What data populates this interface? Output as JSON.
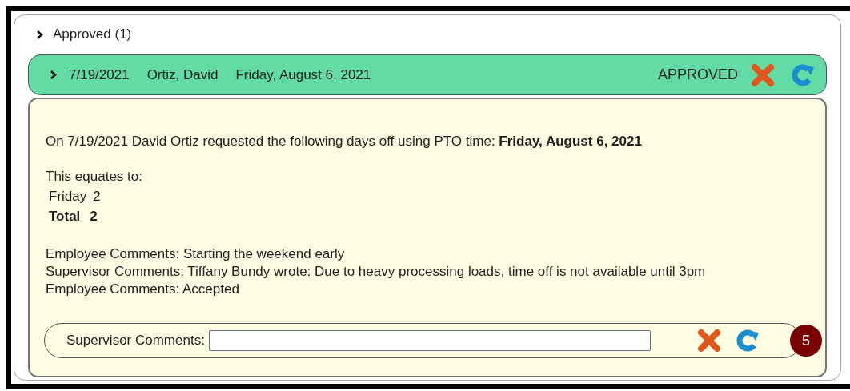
{
  "section": {
    "label": "Approved (1)"
  },
  "request": {
    "date": "7/19/2021",
    "employee": "Ortiz, David",
    "days": "Friday, August 6, 2021",
    "status": "APPROVED"
  },
  "details": {
    "summary": "On 7/19/2021 David Ortiz requested the following days off using PTO time: **Friday, August 6, 2021**",
    "equates_label": "This equates to:",
    "breakdown": [
      {
        "kind": "day",
        "label": "Friday",
        "hours": "2"
      },
      {
        "kind": "total",
        "label": "Total",
        "hours": "2"
      }
    ],
    "comments": [
      "Employee Comments: Starting the weekend early",
      "Supervisor Comments: Tiffany Bundy wrote: Due to heavy processing loads, time off is not available until 3pm",
      "Employee Comments: Accepted"
    ]
  },
  "comment_form": {
    "label": "Supervisor Comments:",
    "badge": "5"
  }
}
